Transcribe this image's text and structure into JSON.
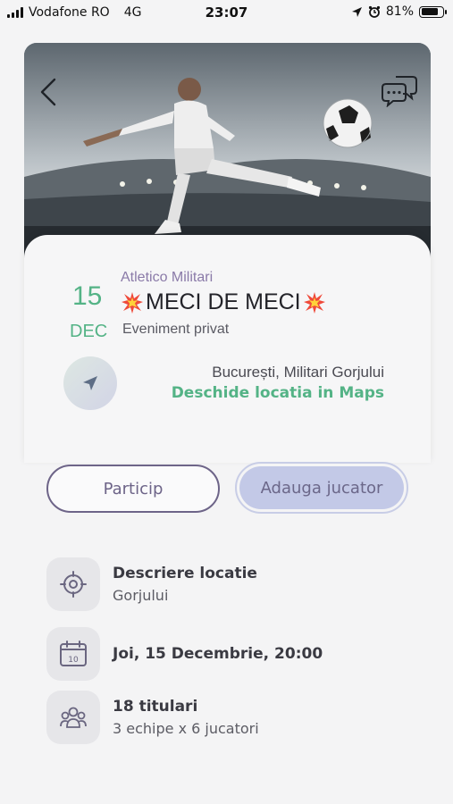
{
  "status_bar": {
    "carrier": "Vodafone RO",
    "network": "4G",
    "time": "23:07",
    "battery_percent": "81%",
    "battery_level": 0.81
  },
  "hero": {
    "back_icon": "chevron-left-icon",
    "chat_icon": "chat-bubbles-icon"
  },
  "event": {
    "date_day": "15",
    "date_month": "DEC",
    "club": "Atletico Militari",
    "title": "MECI DE MECI",
    "title_emoji": "collision-emoji",
    "privacy": "Eveniment privat",
    "address": "București, Militari Gorjului",
    "maps_link": "Deschide locatia in Maps"
  },
  "actions": {
    "participate": "Particip",
    "add_player": "Adauga jucator"
  },
  "details": {
    "location_title": "Descriere locatie",
    "location_sub": "Gorjului",
    "datetime": "Joi, 15 Decembrie, 20:00",
    "calendar_day": "10",
    "players_title": "18 titulari",
    "players_sub": "3 echipe x 6 jucatori"
  },
  "colors": {
    "accent_green": "#54b386",
    "accent_purple": "#6d6488",
    "button_fill": "#c3c9e7"
  }
}
